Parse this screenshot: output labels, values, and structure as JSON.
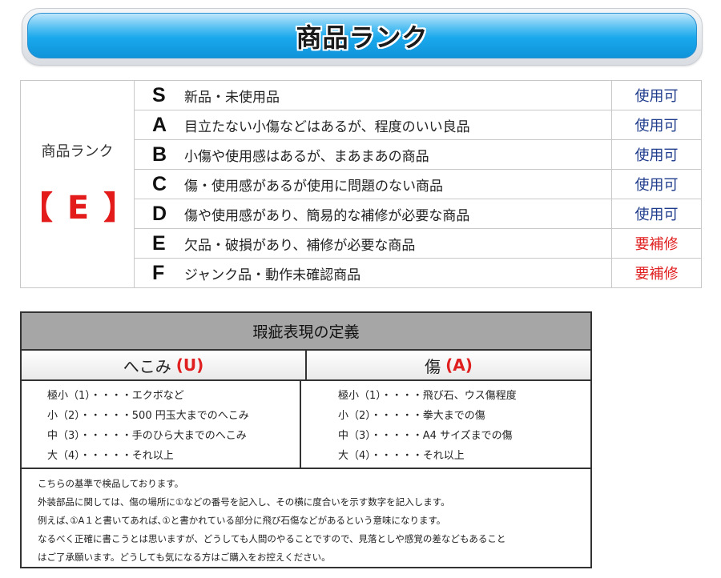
{
  "banner": {
    "title": "商品ランク"
  },
  "rank": {
    "label": "商品ランク",
    "current": "【 E 】",
    "rows": [
      {
        "letter": "S",
        "desc": "新品・未使用品",
        "status": "使用可"
      },
      {
        "letter": "A",
        "desc": "目立たない小傷などはあるが、程度のいい良品",
        "status": "使用可"
      },
      {
        "letter": "B",
        "desc": "小傷や使用感はあるが、まあまあの商品",
        "status": "使用可"
      },
      {
        "letter": "C",
        "desc": "傷・使用感があるが使用に問題のない商品",
        "status": "使用可"
      },
      {
        "letter": "D",
        "desc": "傷や使用感があり、簡易的な補修が必要な商品",
        "status": "使用可"
      },
      {
        "letter": "E",
        "desc": "欠品・破損があり、補修が必要な商品",
        "status": "要補修"
      },
      {
        "letter": "F",
        "desc": "ジャンク品・動作未確認商品",
        "status": "要補修"
      }
    ]
  },
  "definition": {
    "title": "瑕疵表現の定義",
    "dent": {
      "label": "へこみ",
      "code": "(U)",
      "scale": [
        "極小（1）・・・・エクボなど",
        "小（2）・・・・・500 円玉大までのへこみ",
        "中（3）・・・・・手のひら大までのへこみ",
        "大（4）・・・・・それ以上"
      ]
    },
    "scratch": {
      "label": "傷",
      "code": "(A)",
      "scale": [
        "極小（1）・・・・飛び石、ウス傷程度",
        "小（2）・・・・・拳大までの傷",
        "中（3）・・・・・A4 サイズまでの傷",
        "大（4）・・・・・それ以上"
      ]
    },
    "notes": [
      "こちらの基準で検品しております。",
      "外装部品に関しては、傷の場所に①などの番号を記入し、その横に度合いを示す数字を記入します。",
      "例えば､①A１と書いてあれば､①と書かれている部分に飛び石傷などがあるという意味になります。",
      "なるべく正確に書こうとは思いますが、どうしても人間のやることですので、見落としや感覚の差などもあること",
      "はご了承願います。どうしても気になる方はご購入をお控えください。"
    ]
  },
  "colors": {
    "ok": "#1f3c8c",
    "ng": "#e02020",
    "current_rank": "#e41b1b"
  }
}
